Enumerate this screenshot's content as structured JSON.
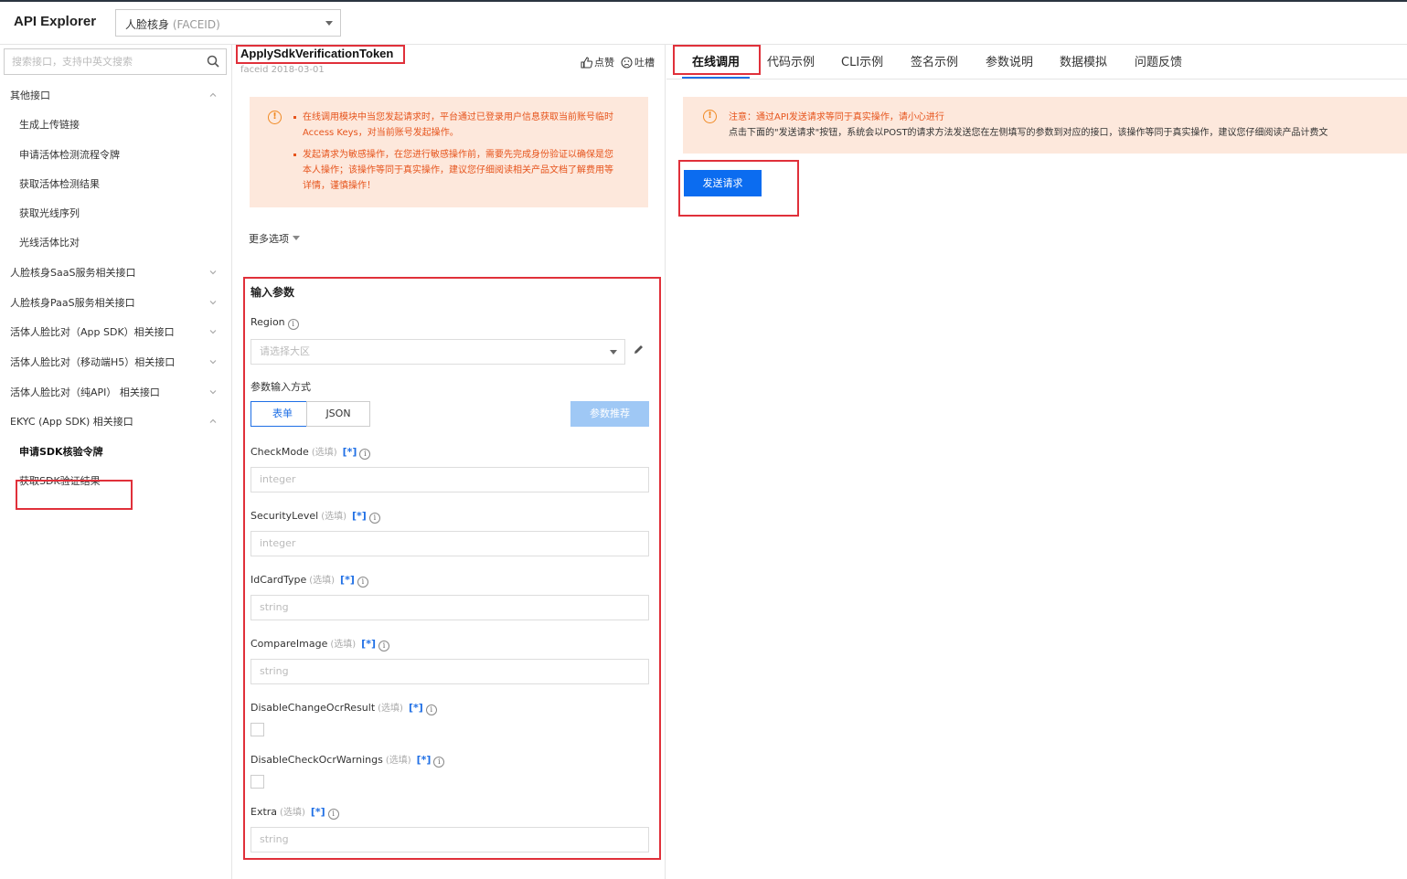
{
  "header": {
    "app_title": "API Explorer",
    "product_name": "人脸核身",
    "product_code": "(FACEID)"
  },
  "sidebar": {
    "search_placeholder": "搜索接口，支持中英文搜索",
    "items": [
      {
        "label": "其他接口",
        "type": "group",
        "expanded": true
      },
      {
        "label": "生成上传链接",
        "type": "child"
      },
      {
        "label": "申请活体检测流程令牌",
        "type": "child"
      },
      {
        "label": "获取活体检测结果",
        "type": "child"
      },
      {
        "label": "获取光线序列",
        "type": "child"
      },
      {
        "label": "光线活体比对",
        "type": "child"
      },
      {
        "label": "人脸核身SaaS服务相关接口",
        "type": "group",
        "expanded": false
      },
      {
        "label": "人脸核身PaaS服务相关接口",
        "type": "group",
        "expanded": false
      },
      {
        "label": "活体人脸比对（App SDK）相关接口",
        "type": "group",
        "expanded": false
      },
      {
        "label": "活体人脸比对（移动端H5）相关接口",
        "type": "group",
        "expanded": false
      },
      {
        "label": "活体人脸比对（纯API） 相关接口",
        "type": "group",
        "expanded": false
      },
      {
        "label": "EKYC (App SDK) 相关接口",
        "type": "group",
        "expanded": true
      },
      {
        "label": "申请SDK核验令牌",
        "type": "child",
        "active": true
      },
      {
        "label": "获取SDK验证结果",
        "type": "child"
      }
    ]
  },
  "api": {
    "name": "ApplySdkVerificationToken",
    "version": "faceid 2018-03-01",
    "like_label": "点赞",
    "complain_label": "吐槽"
  },
  "notice_mid": {
    "items": [
      "在线调用模块中当您发起请求时，平台通过已登录用户信息获取当前账号临时Access Keys，对当前账号发起操作。",
      "发起请求为敏感操作，在您进行敏感操作前，需要先完成身份验证以确保是您本人操作；该操作等同于真实操作，建议您仔细阅读相关产品文档了解费用等详情，谨慎操作！"
    ]
  },
  "more_options": "更多选项",
  "input_params": {
    "title": "输入参数",
    "region_label": "Region",
    "region_placeholder": "请选择大区",
    "mode_label": "参数输入方式",
    "mode_tabs": [
      "表单",
      "JSON"
    ],
    "recommend_label": "参数推荐",
    "optional_tag": "(选填)",
    "star_tag": "[*]",
    "fields": [
      {
        "name": "CheckMode",
        "placeholder": "integer",
        "kind": "text"
      },
      {
        "name": "SecurityLevel",
        "placeholder": "integer",
        "kind": "text"
      },
      {
        "name": "IdCardType",
        "placeholder": "string",
        "kind": "text"
      },
      {
        "name": "CompareImage",
        "placeholder": "string",
        "kind": "text"
      },
      {
        "name": "DisableChangeOcrResult",
        "placeholder": "",
        "kind": "checkbox"
      },
      {
        "name": "DisableCheckOcrWarnings",
        "placeholder": "",
        "kind": "checkbox"
      },
      {
        "name": "Extra",
        "placeholder": "string",
        "kind": "text"
      }
    ]
  },
  "right": {
    "tabs": [
      "在线调用",
      "代码示例",
      "CLI示例",
      "签名示例",
      "参数说明",
      "数据模拟",
      "问题反馈"
    ],
    "active_tab": 0,
    "notice_line1": "注意：通过API发送请求等同于真实操作，请小心进行",
    "notice_line2": "点击下面的\"发送请求\"按钮，系统会以POST的请求方法发送您在左侧填写的参数到对应的接口，该操作等同于真实操作，建议您仔细阅读产品计费文",
    "send_label": "发送请求"
  },
  "colors": {
    "accent": "#1f6fe5",
    "highlight_red": "#e0303a",
    "notice_bg": "#fde8dc",
    "notice_text": "#e6541c",
    "send_button": "#0b6cf0"
  }
}
